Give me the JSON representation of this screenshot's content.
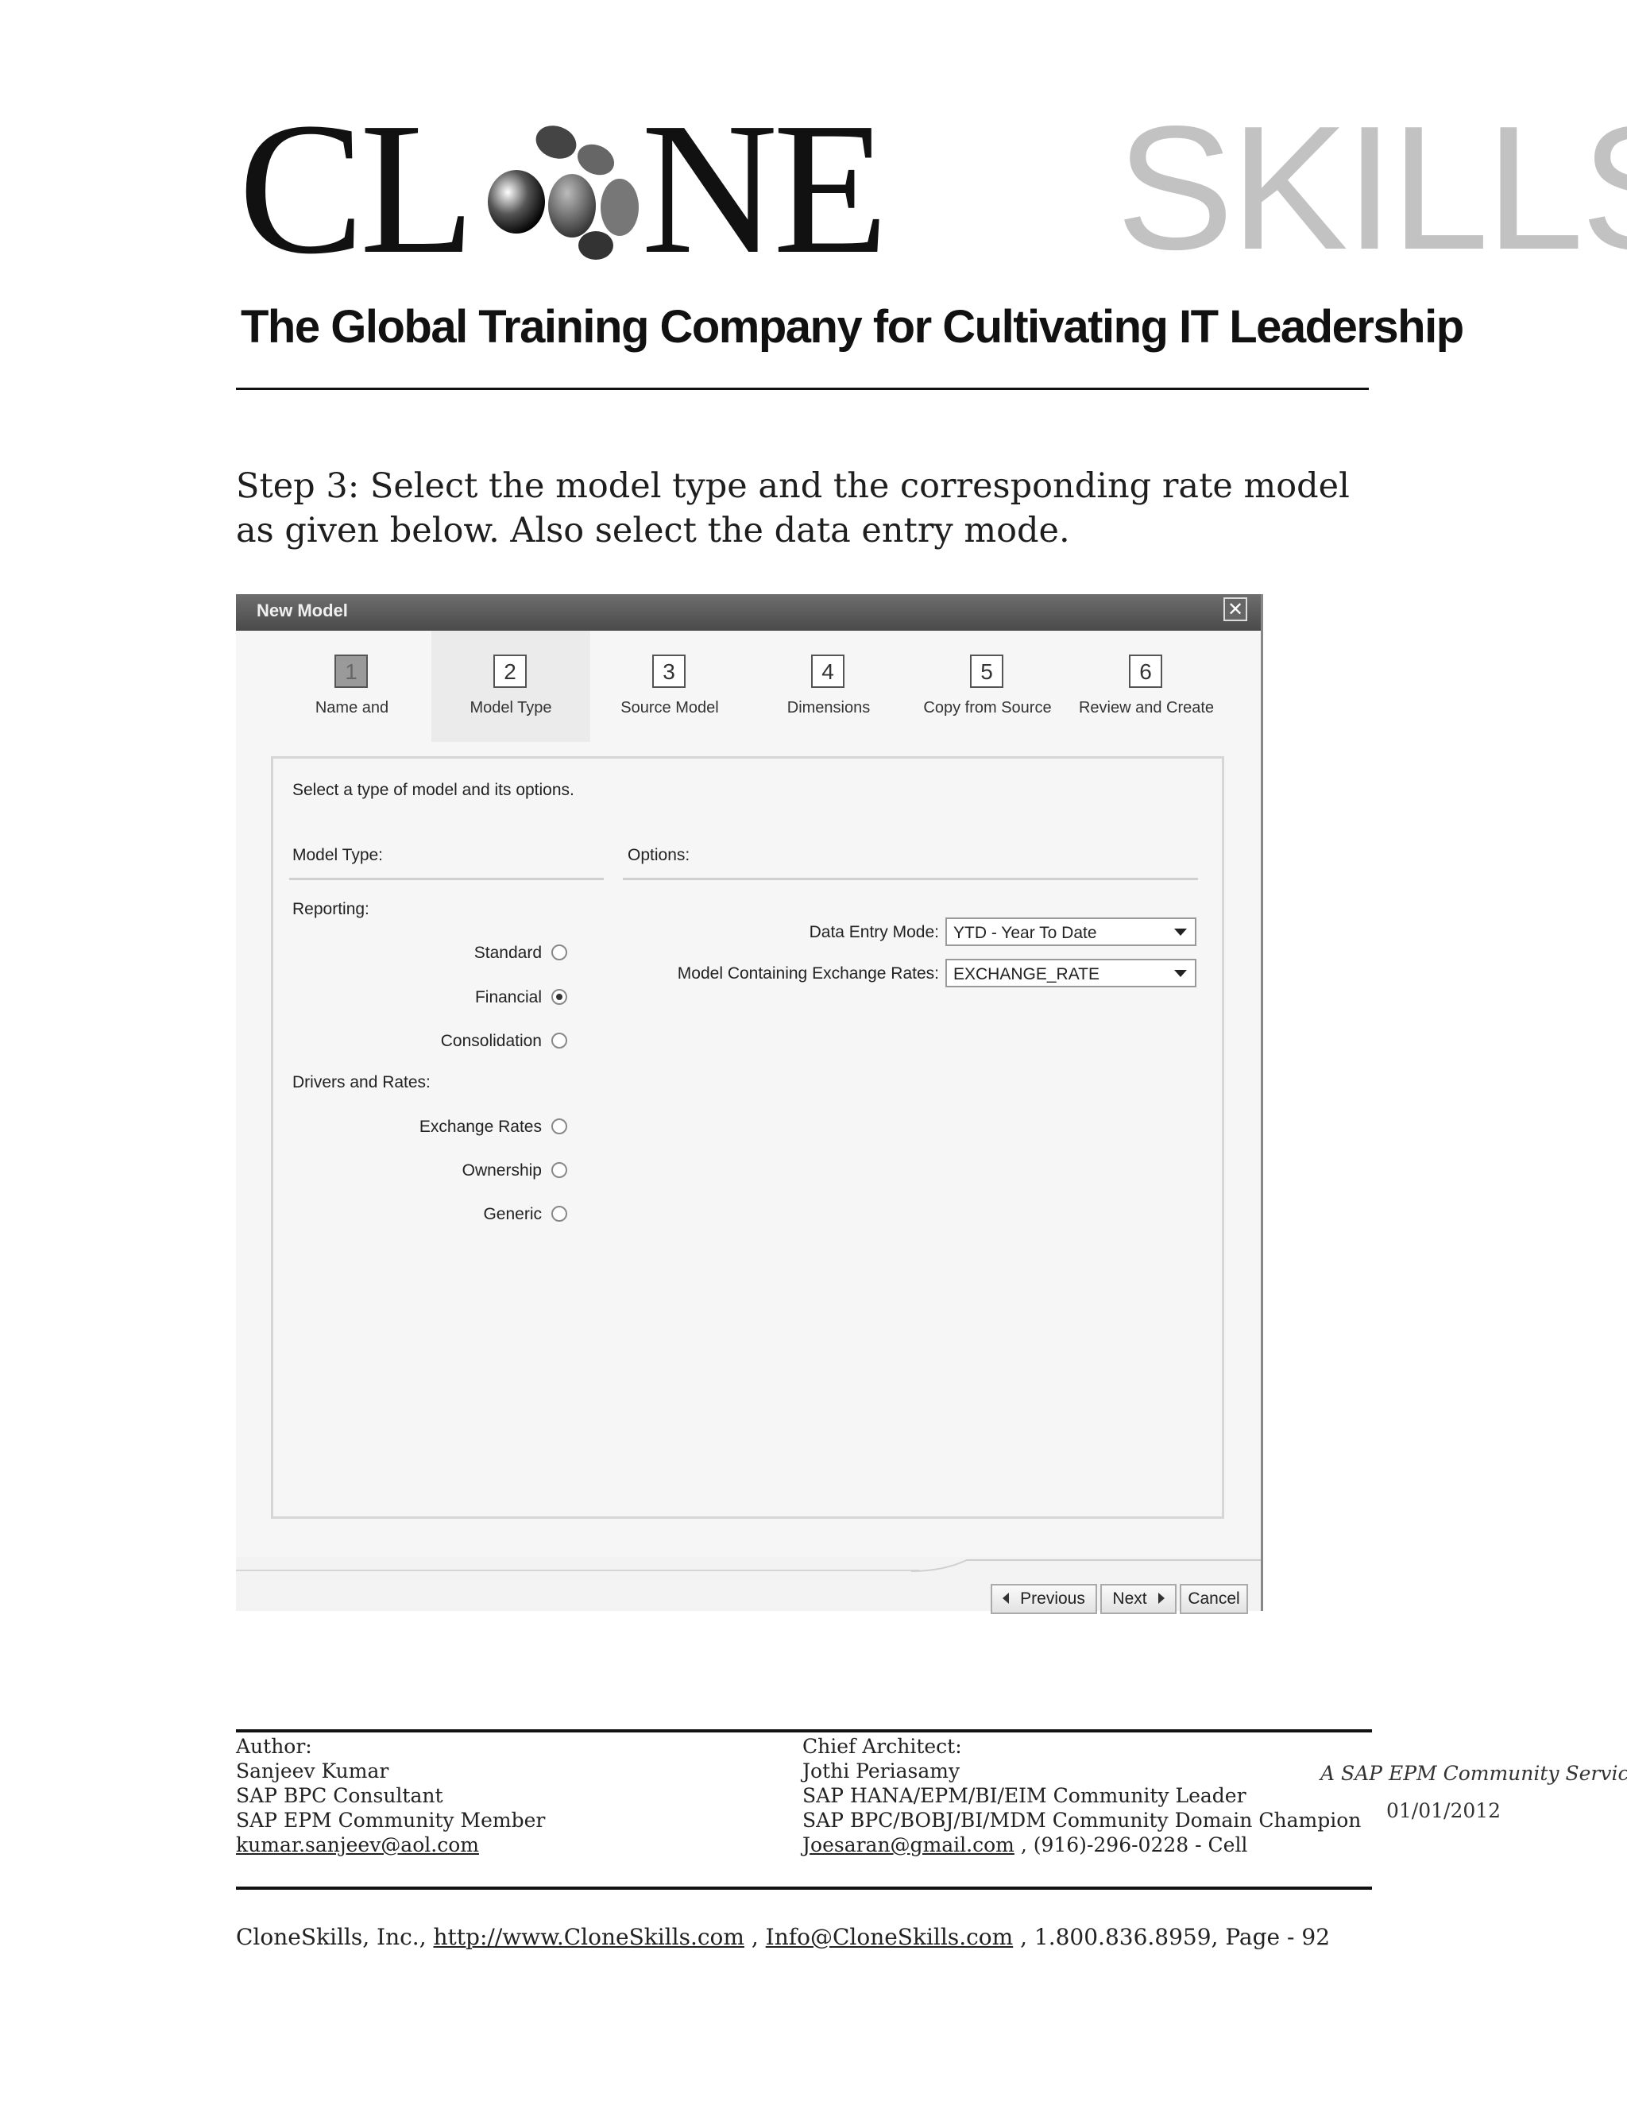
{
  "logo": {
    "text_left": "CL",
    "text_mid": "NE",
    "text_right": "SKILLS"
  },
  "tagline": "The Global Training Company for Cultivating IT Leadership",
  "step_text": "Step 3: Select the model type and the corresponding rate model as given below. Also select the data entry mode.",
  "dialog": {
    "title": "New Model",
    "close_glyph": "✕",
    "steps": [
      {
        "num": "1",
        "label": "Name and"
      },
      {
        "num": "2",
        "label": "Model Type"
      },
      {
        "num": "3",
        "label": "Source Model"
      },
      {
        "num": "4",
        "label": "Dimensions"
      },
      {
        "num": "5",
        "label": "Copy from Source"
      },
      {
        "num": "6",
        "label": "Review and Create"
      }
    ],
    "intro": "Select a type of model and its options.",
    "model_type_header": "Model Type:",
    "options_header": "Options:",
    "reporting_group": "Reporting:",
    "reporting_options": [
      {
        "label": "Standard",
        "selected": false
      },
      {
        "label": "Financial",
        "selected": true
      },
      {
        "label": "Consolidation",
        "selected": false
      }
    ],
    "drivers_group": "Drivers and Rates:",
    "drivers_options": [
      {
        "label": "Exchange Rates",
        "selected": false
      },
      {
        "label": "Ownership",
        "selected": false
      },
      {
        "label": "Generic",
        "selected": false
      }
    ],
    "data_entry_mode": {
      "label": "Data Entry Mode:",
      "value": "YTD - Year To Date"
    },
    "exchange_rate_model": {
      "label": "Model Containing Exchange Rates:",
      "value": "EXCHANGE_RATE"
    },
    "buttons": {
      "previous": "Previous",
      "next": "Next",
      "cancel": "Cancel"
    }
  },
  "footer": {
    "author": {
      "heading": "Author:",
      "name": "Sanjeev Kumar",
      "role1": "SAP BPC Consultant",
      "role2": "SAP EPM Community Member",
      "email": "kumar.sanjeev@aol.com"
    },
    "architect": {
      "heading": "Chief Architect:",
      "name": "Jothi Periasamy",
      "role1": "SAP HANA/EPM/BI/EIM Community Leader",
      "role2": "SAP BPC/BOBJ/BI/MDM Community Domain Champion",
      "email": "Joesaran@gmail.com",
      "phone": " , (916)-296-0228 - Cell"
    },
    "service": "A SAP EPM Community Service",
    "date": "01/01/2012",
    "company": "CloneSkills, Inc., ",
    "website": "http://www.CloneSkills.com",
    "sep": " , ",
    "info_email": "Info@CloneSkills.com",
    "phone_page": " , 1.800.836.8959, Page - 92"
  }
}
